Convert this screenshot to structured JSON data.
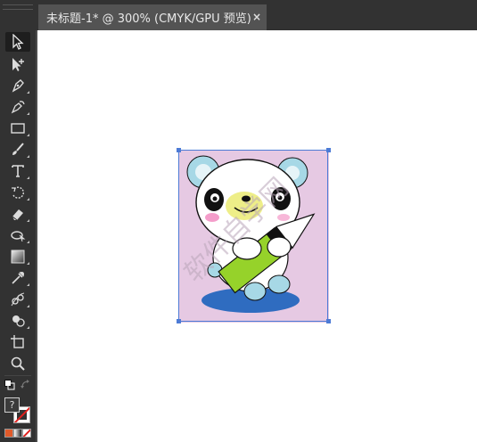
{
  "document_tab": {
    "title": "未标题-1* @ 300% (CMYK/GPU 预览)",
    "close_label": "×"
  },
  "toolbar": {
    "tools": [
      {
        "name": "selection-tool-icon",
        "active": true
      },
      {
        "name": "direct-selection-tool-icon"
      },
      {
        "name": "pen-tool-icon"
      },
      {
        "name": "curvature-tool-icon"
      },
      {
        "name": "rectangle-tool-icon"
      },
      {
        "name": "paintbrush-tool-icon"
      },
      {
        "name": "type-tool-icon"
      },
      {
        "name": "rotate-tool-icon"
      },
      {
        "name": "eraser-tool-icon"
      },
      {
        "name": "warp-tool-icon"
      },
      {
        "name": "gradient-tool-icon"
      },
      {
        "name": "eyedropper-tool-icon"
      },
      {
        "name": "blend-tool-icon"
      },
      {
        "name": "shape-builder-tool-icon"
      },
      {
        "name": "artboard-tool-icon"
      },
      {
        "name": "zoom-tool-icon"
      }
    ],
    "help_glyph": "?",
    "fill_color": "#ffffff",
    "stroke_color": "none"
  },
  "artwork": {
    "background": "#e6c9e3",
    "shadow": "#2f6cc0",
    "pencil_green": "#96d22a",
    "ear_blue": "#a7d8e6",
    "cheek_pink": "#f07cb8",
    "muzzle_yellow": "#eeee88"
  },
  "watermark": {
    "text": "软件自学网"
  },
  "colors": {
    "ui_dark": "#323232",
    "tab_active": "#535353",
    "selection": "#4d7bd6"
  }
}
